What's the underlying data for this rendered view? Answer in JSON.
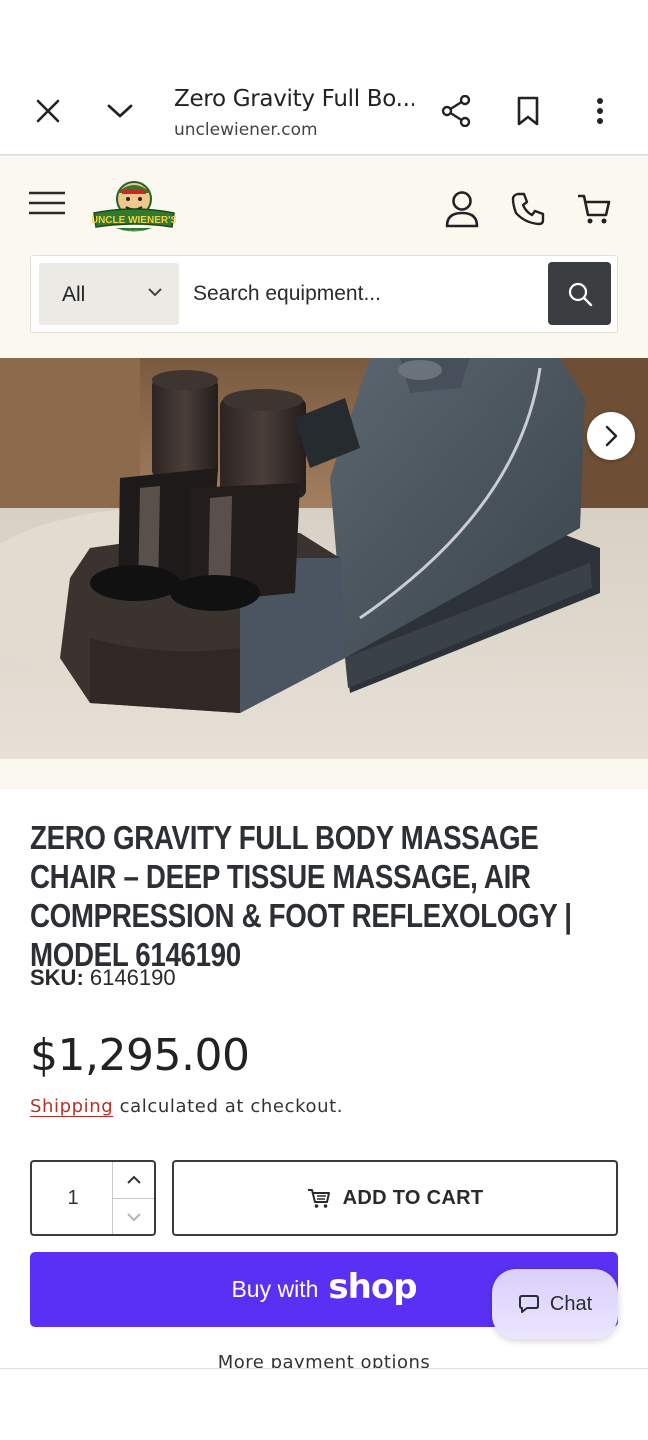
{
  "browser": {
    "tab_title": "Zero Gravity Full Bo...",
    "url": "unclewiener.com"
  },
  "header": {
    "logo_text": "UNCLE WIENER'S",
    "logo_subtext": "WHOLESALE"
  },
  "search": {
    "category": "All",
    "placeholder": "Search equipment..."
  },
  "product": {
    "title": "Zero Gravity Full Body Massage Chair – Deep Tissue Massage, Air Compression & Foot Reflexology | Model 6146190",
    "sku_label": "SKU:",
    "sku_value": "6146190",
    "price": "$1,295.00",
    "shipping_link": "Shipping",
    "shipping_text": "calculated at checkout.",
    "quantity": "1"
  },
  "actions": {
    "add_to_cart": "ADD TO CART",
    "buy_prefix": "Buy with",
    "buy_brand": "shop",
    "chat": "Chat",
    "more_payment": "More payment options"
  },
  "colors": {
    "shop_purple": "#5a31f4",
    "header_bg": "#fbf8ef",
    "link_red": "#b5322b"
  },
  "icons": [
    "close-icon",
    "chevron-down-icon",
    "share-icon",
    "bookmark-icon",
    "more-vert-icon",
    "menu-icon",
    "account-icon",
    "phone-icon",
    "cart-icon",
    "search-icon",
    "chevron-right-icon",
    "chat-icon"
  ]
}
